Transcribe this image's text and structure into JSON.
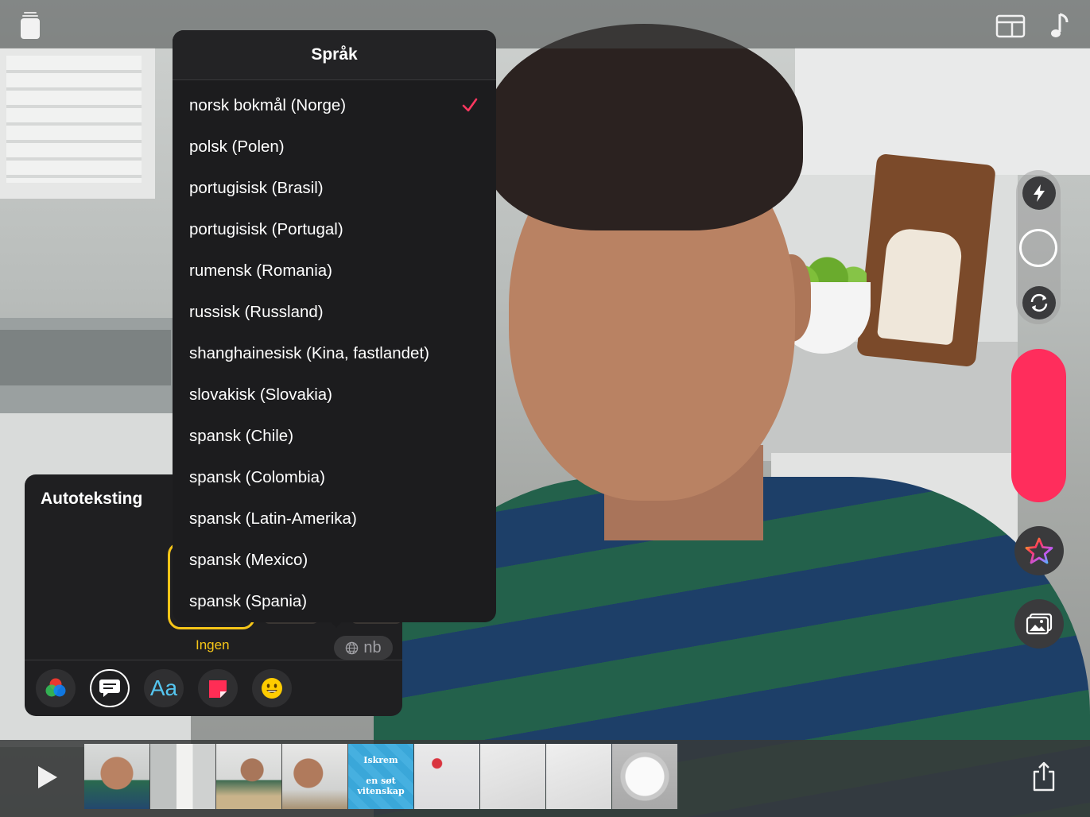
{
  "popover": {
    "title": "Språk",
    "selected_index": 0,
    "languages": [
      "norsk bokmål (Norge)",
      "polsk (Polen)",
      "portugisisk (Brasil)",
      "portugisisk (Portugal)",
      "rumensk (Romania)",
      "russisk (Russland)",
      "shanghainesisk (Kina, fastlandet)",
      "slovakisk (Slovakia)",
      "spansk (Chile)",
      "spansk (Colombia)",
      "spansk (Latin-Amerika)",
      "spansk (Mexico)",
      "spansk (Spania)"
    ]
  },
  "caption_panel": {
    "title": "Autoteksting",
    "selected_style_label": "Ingen",
    "language_code": "nb"
  },
  "timeline": {
    "thumbnails": [
      {
        "kind": "boy-closeup"
      },
      {
        "kind": "kitchen-milk"
      },
      {
        "kind": "boy-table"
      },
      {
        "kind": "boy-lying"
      },
      {
        "kind": "title-card",
        "line1": "Iskrem",
        "line2": "en søt",
        "line3": "vitenskap"
      },
      {
        "kind": "ingredients"
      },
      {
        "kind": "countertop"
      },
      {
        "kind": "countertop-2"
      },
      {
        "kind": "bowl-ice"
      }
    ]
  },
  "colors": {
    "accent_check": "#ff375f",
    "record": "#ff2d5c",
    "selected_style": "#f5c518",
    "text_style": "#55c6f0",
    "title_card_bg": "#3aa7d9"
  },
  "icons": {
    "top_left": "projects-icon",
    "top_right": [
      "layout-icon",
      "music-note-icon"
    ],
    "side": [
      "flash-icon",
      "shutter-ring",
      "flip-camera-icon",
      "star-effects-icon",
      "photo-library-icon"
    ],
    "toolbar": [
      "color-filters-icon",
      "captions-icon",
      "text-style-icon",
      "sticker-icon",
      "emoji-icon"
    ],
    "timeline": [
      "play-icon",
      "share-icon"
    ]
  }
}
